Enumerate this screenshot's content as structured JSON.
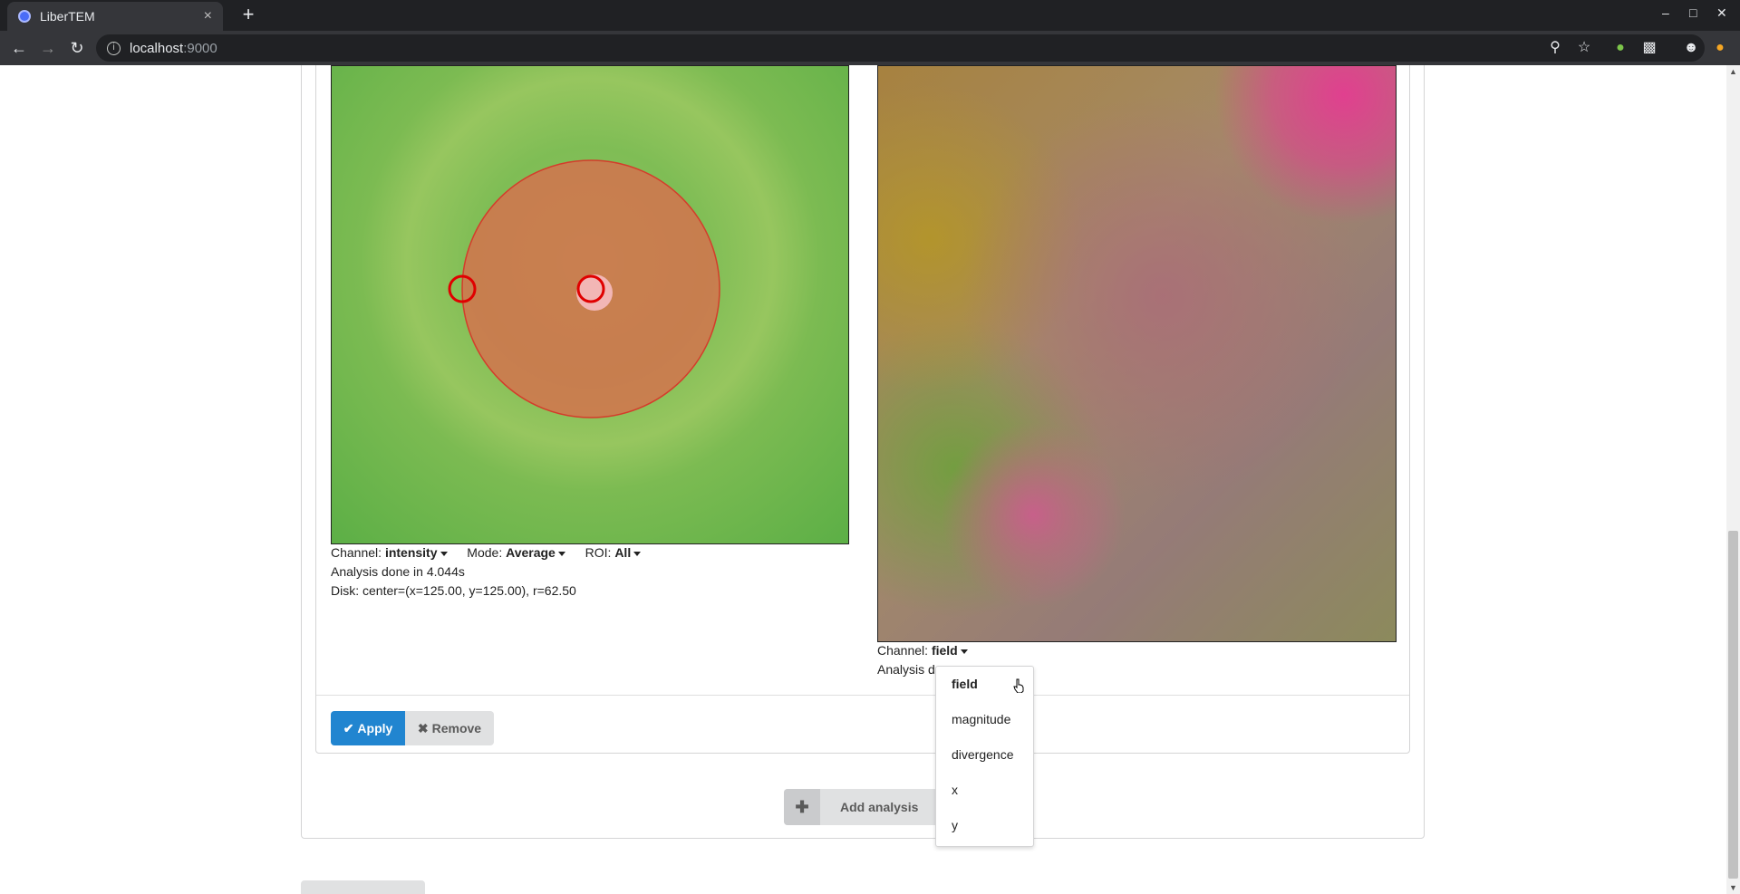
{
  "browser": {
    "tab_title": "LiberTEM",
    "url_host": "localhost",
    "url_port": ":9000",
    "new_tab": "+",
    "close_tab": "×"
  },
  "left_panel": {
    "channel_label": "Channel:",
    "channel_value": "intensity",
    "mode_label": "Mode:",
    "mode_value": "Average",
    "roi_label": "ROI:",
    "roi_value": "All",
    "status": "Analysis done in 4.044s",
    "disk": "Disk: center=(x=125.00, y=125.00), r=62.50"
  },
  "right_panel": {
    "channel_label": "Channel:",
    "channel_value": "field",
    "status_partial": "Analysis d"
  },
  "buttons": {
    "apply": "Apply",
    "remove": "Remove",
    "add_analysis": "Add analysis"
  },
  "channel_menu": {
    "options": [
      "field",
      "magnitude",
      "divergence",
      "x",
      "y"
    ],
    "selected": "field"
  },
  "colors": {
    "primary_blue": "#2185d0",
    "disk_fill": "#d4734e",
    "handle_red": "#e00000"
  }
}
